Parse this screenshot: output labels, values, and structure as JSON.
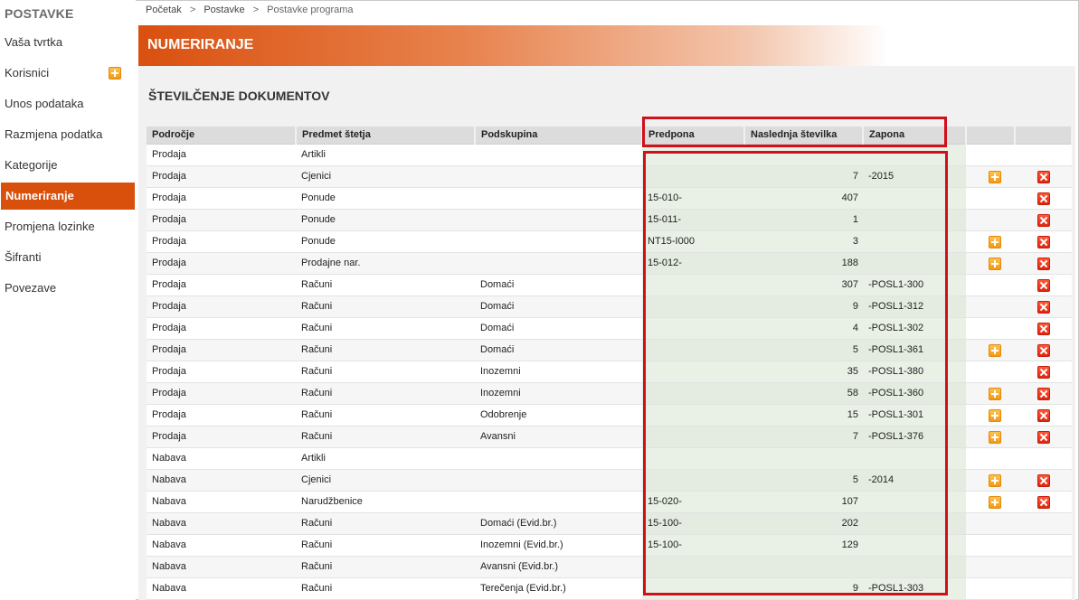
{
  "sidebar": {
    "title": "POSTAVKE",
    "items": [
      {
        "label": "Vaša tvrtka",
        "active": false,
        "has_add": false
      },
      {
        "label": "Korisnici",
        "active": false,
        "has_add": true
      },
      {
        "label": "Unos podataka",
        "active": false,
        "has_add": false
      },
      {
        "label": "Razmjena podatka",
        "active": false,
        "has_add": false
      },
      {
        "label": "Kategorije",
        "active": false,
        "has_add": false
      },
      {
        "label": "Numeriranje",
        "active": true,
        "has_add": false
      },
      {
        "label": "Promjena lozinke",
        "active": false,
        "has_add": false
      },
      {
        "label": "Šifranti",
        "active": false,
        "has_add": false
      },
      {
        "label": "Povezave",
        "active": false,
        "has_add": false
      }
    ]
  },
  "breadcrumb": {
    "home": "Početak",
    "separator": ">",
    "settings": "Postavke",
    "current": "Postavke programa"
  },
  "banner": {
    "title": "NUMERIRANJE"
  },
  "section": {
    "title": "ŠTEVILČENJE DOKUMENTOV"
  },
  "table": {
    "headers": [
      "Področje",
      "Predmet štetja",
      "Podskupina",
      "Predpona",
      "Naslednja številka",
      "Zapona",
      "",
      ""
    ],
    "rows": [
      {
        "area": "Prodaja",
        "subject": "Artikli",
        "subgroup": "",
        "prefix": "",
        "next": "",
        "suffix": "",
        "add": false,
        "del": false
      },
      {
        "area": "Prodaja",
        "subject": "Cjenici",
        "subgroup": "",
        "prefix": "",
        "next": "7",
        "suffix": "-2015",
        "add": true,
        "del": true
      },
      {
        "area": "Prodaja",
        "subject": "Ponude",
        "subgroup": "",
        "prefix": "15-010-",
        "next": "407",
        "suffix": "",
        "add": false,
        "del": true
      },
      {
        "area": "Prodaja",
        "subject": "Ponude",
        "subgroup": "",
        "prefix": "15-011-",
        "next": "1",
        "suffix": "",
        "add": false,
        "del": true
      },
      {
        "area": "Prodaja",
        "subject": "Ponude",
        "subgroup": "",
        "prefix": "NT15-I000",
        "next": "3",
        "suffix": "",
        "add": true,
        "del": true
      },
      {
        "area": "Prodaja",
        "subject": "Prodajne nar.",
        "subgroup": "",
        "prefix": "15-012-",
        "next": "188",
        "suffix": "",
        "add": true,
        "del": true
      },
      {
        "area": "Prodaja",
        "subject": "Računi",
        "subgroup": "Domaći",
        "prefix": "",
        "next": "307",
        "suffix": "-POSL1-300",
        "add": false,
        "del": true
      },
      {
        "area": "Prodaja",
        "subject": "Računi",
        "subgroup": "Domaći",
        "prefix": "",
        "next": "9",
        "suffix": "-POSL1-312",
        "add": false,
        "del": true
      },
      {
        "area": "Prodaja",
        "subject": "Računi",
        "subgroup": "Domaći",
        "prefix": "",
        "next": "4",
        "suffix": "-POSL1-302",
        "add": false,
        "del": true
      },
      {
        "area": "Prodaja",
        "subject": "Računi",
        "subgroup": "Domaći",
        "prefix": "",
        "next": "5",
        "suffix": "-POSL1-361",
        "add": true,
        "del": true
      },
      {
        "area": "Prodaja",
        "subject": "Računi",
        "subgroup": "Inozemni",
        "prefix": "",
        "next": "35",
        "suffix": "-POSL1-380",
        "add": false,
        "del": true
      },
      {
        "area": "Prodaja",
        "subject": "Računi",
        "subgroup": "Inozemni",
        "prefix": "",
        "next": "58",
        "suffix": "-POSL1-360",
        "add": true,
        "del": true
      },
      {
        "area": "Prodaja",
        "subject": "Računi",
        "subgroup": "Odobrenje",
        "prefix": "",
        "next": "15",
        "suffix": "-POSL1-301",
        "add": true,
        "del": true
      },
      {
        "area": "Prodaja",
        "subject": "Računi",
        "subgroup": "Avansni",
        "prefix": "",
        "next": "7",
        "suffix": "-POSL1-376",
        "add": true,
        "del": true
      },
      {
        "area": "Nabava",
        "subject": "Artikli",
        "subgroup": "",
        "prefix": "",
        "next": "",
        "suffix": "",
        "add": false,
        "del": false
      },
      {
        "area": "Nabava",
        "subject": "Cjenici",
        "subgroup": "",
        "prefix": "",
        "next": "5",
        "suffix": "-2014",
        "add": true,
        "del": true
      },
      {
        "area": "Nabava",
        "subject": "Narudžbenice",
        "subgroup": "",
        "prefix": "15-020-",
        "next": "107",
        "suffix": "",
        "add": true,
        "del": true
      },
      {
        "area": "Nabava",
        "subject": "Računi",
        "subgroup": "Domaći (Evid.br.)",
        "prefix": "15-100-",
        "next": "202",
        "suffix": "",
        "add": false,
        "del": false
      },
      {
        "area": "Nabava",
        "subject": "Računi",
        "subgroup": "Inozemni (Evid.br.)",
        "prefix": "15-100-",
        "next": "129",
        "suffix": "",
        "add": false,
        "del": false
      },
      {
        "area": "Nabava",
        "subject": "Računi",
        "subgroup": "Avansni (Evid.br.)",
        "prefix": "",
        "next": "",
        "suffix": "",
        "add": false,
        "del": false
      },
      {
        "area": "Nabava",
        "subject": "Računi",
        "subgroup": "Terečenja (Evid.br.)",
        "prefix": "",
        "next": "9",
        "suffix": "-POSL1-303",
        "add": false,
        "del": false
      }
    ]
  },
  "colors": {
    "accent": "#d94f0c",
    "highlight_border": "#d0101a",
    "add_icon": "#f39a12",
    "delete_icon": "#e0250f"
  }
}
